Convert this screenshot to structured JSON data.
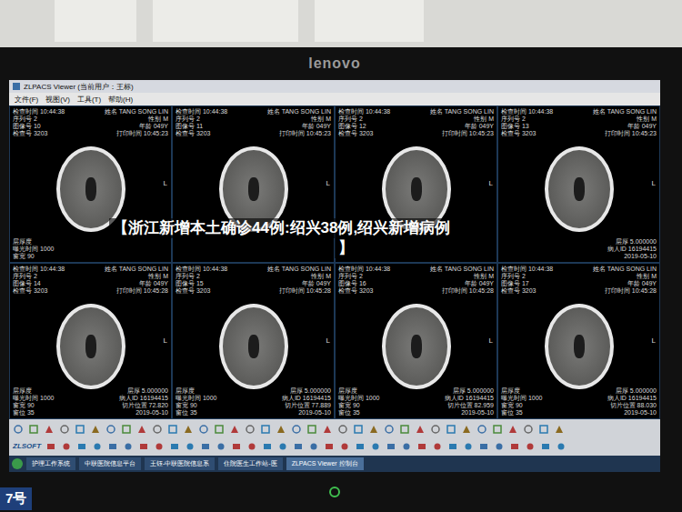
{
  "monitor": {
    "brand": "lenovo"
  },
  "window": {
    "title": "ZLPACS Viewer (当前用户：王标)"
  },
  "menu": [
    "文件(F)",
    "视图(V)",
    "工具(T)",
    "帮助(H)"
  ],
  "panels": [
    {
      "top_left": [
        "检查时间 10:44:38",
        "序列号 2",
        "图像号 10",
        "检查号 3203"
      ],
      "top_right": [
        "姓名 TANG SONG LIN",
        "性别 M",
        "年龄 049Y",
        "打印时间 10:45:23"
      ],
      "bottom_left": [
        "层厚度",
        "曝光时间 1000",
        "窗宽 90"
      ],
      "bottom_right": [],
      "marker": "L"
    },
    {
      "top_left": [
        "检查时间 10:44:38",
        "序列号 2",
        "图像号 11",
        "检查号 3203"
      ],
      "top_right": [
        "姓名 TANG SONG LIN",
        "性别 M",
        "年龄 049Y",
        "打印时间 10:45:23"
      ],
      "bottom_left": [],
      "bottom_right": [],
      "marker": "L"
    },
    {
      "top_left": [
        "检查时间 10:44:38",
        "序列号 2",
        "图像号 12",
        "检查号 3203"
      ],
      "top_right": [
        "姓名 TANG SONG LIN",
        "性别 M",
        "年龄 049Y",
        "打印时间 10:45:23"
      ],
      "bottom_left": [],
      "bottom_right": [],
      "marker": "L"
    },
    {
      "top_left": [
        "检查时间 10:44:38",
        "序列号 2",
        "图像号 13",
        "检查号 3203"
      ],
      "top_right": [
        "姓名 TANG SONG LIN",
        "性别 M",
        "年龄 049Y",
        "打印时间 10:45:23"
      ],
      "bottom_left": [],
      "bottom_right": [
        "层厚 5.000000",
        "病人ID 16194415",
        "2019-05-10"
      ],
      "marker": "L"
    },
    {
      "top_left": [
        "检查时间 10:44:38",
        "序列号 2",
        "图像号 14",
        "检查号 3203"
      ],
      "top_right": [
        "姓名 TANG SONG LIN",
        "性别 M",
        "年龄 049Y",
        "打印时间 10:45:28"
      ],
      "bottom_left": [
        "层厚度",
        "曝光时间 1000",
        "窗宽 90",
        "窗位 35"
      ],
      "bottom_right": [
        "层厚 5.000000",
        "病人ID 16194415",
        "切片位置 72.820",
        "2019-05-10"
      ],
      "marker": "L"
    },
    {
      "top_left": [
        "检查时间 10:44:38",
        "序列号 2",
        "图像号 15",
        "检查号 3203"
      ],
      "top_right": [
        "姓名 TANG SONG LIN",
        "性别 M",
        "年龄 049Y",
        "打印时间 10:45:28"
      ],
      "bottom_left": [
        "层厚度",
        "曝光时间 1000",
        "窗宽 90",
        "窗位 35"
      ],
      "bottom_right": [
        "层厚 5.000000",
        "病人ID 16194415",
        "切片位置 77.889",
        "2019-05-10"
      ],
      "marker": "L"
    },
    {
      "top_left": [
        "检查时间 10:44:38",
        "序列号 2",
        "图像号 16",
        "检查号 3203"
      ],
      "top_right": [
        "姓名 TANG SONG LIN",
        "性别 M",
        "年龄 049Y",
        "打印时间 10:45:28"
      ],
      "bottom_left": [
        "层厚度",
        "曝光时间 1000",
        "窗宽 90",
        "窗位 35"
      ],
      "bottom_right": [
        "层厚 5.000000",
        "病人ID 16194415",
        "切片位置 82.959",
        "2019-05-10"
      ],
      "marker": "L"
    },
    {
      "top_left": [
        "检查时间 10:44:38",
        "序列号 2",
        "图像号 17",
        "检查号 3203"
      ],
      "top_right": [
        "姓名 TANG SONG LIN",
        "性别 M",
        "年龄 049Y",
        "打印时间 10:45:28"
      ],
      "bottom_left": [
        "层厚度",
        "曝光时间 1000",
        "窗宽 90",
        "窗位 35"
      ],
      "bottom_right": [
        "层厚 5.000000",
        "病人ID 16194415",
        "切片位置 88.030",
        "2019-05-10"
      ],
      "marker": "L"
    }
  ],
  "toolbar": {
    "logo": "ZLSOFT"
  },
  "taskbar": {
    "items": [
      {
        "label": "护理工作系统",
        "selected": false
      },
      {
        "label": "中联医院信息平台",
        "selected": false
      },
      {
        "label": "王钰-中联医院信息系",
        "selected": false
      },
      {
        "label": "住院医生工作站-医",
        "selected": false
      },
      {
        "label": "ZLPACS Viewer 控制台",
        "selected": true
      }
    ]
  },
  "caption": {
    "lines": [
      "【浙江新增本土确诊44例:绍兴38例,绍兴新增病例",
      "】"
    ]
  },
  "corner_label": "7号"
}
